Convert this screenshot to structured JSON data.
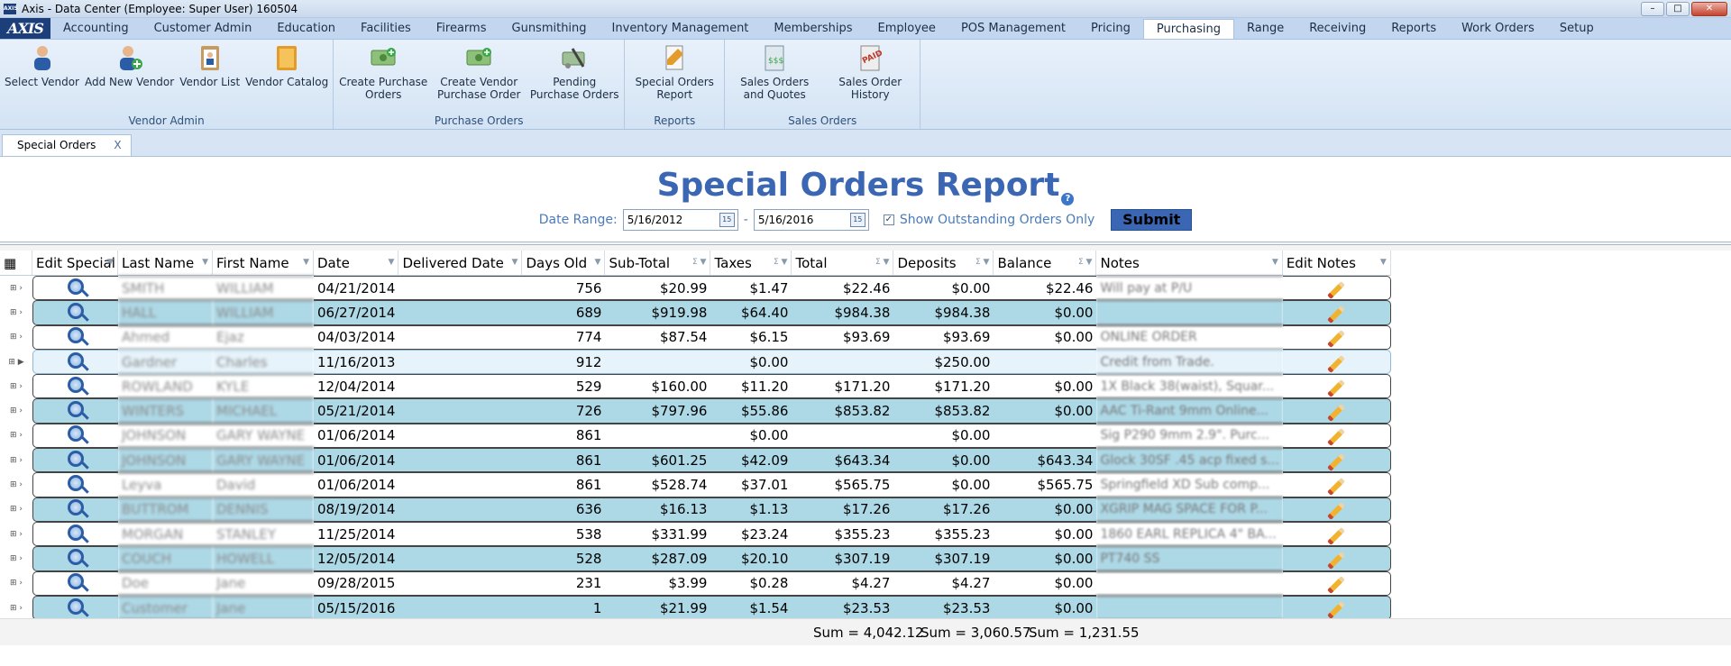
{
  "window": {
    "title": "Axis - Data Center  (Employee: Super User) 160504",
    "app_icon": "AXIS"
  },
  "logo": "AXIS",
  "menu": [
    "Accounting",
    "Customer Admin",
    "Education",
    "Facilities",
    "Firearms",
    "Gunsmithing",
    "Inventory Management",
    "Memberships",
    "Employee",
    "POS Management",
    "Pricing",
    "Purchasing",
    "Range",
    "Receiving",
    "Reports",
    "Work Orders",
    "Setup"
  ],
  "menu_active": "Purchasing",
  "ribbon": {
    "groups": [
      {
        "label": "Vendor Admin",
        "buttons": [
          {
            "label": "Select Vendor",
            "icon": "person-icon"
          },
          {
            "label": "Add New Vendor",
            "icon": "add-person-icon"
          },
          {
            "label": "Vendor List",
            "icon": "clipboard-person-icon"
          },
          {
            "label": "Vendor Catalog",
            "icon": "catalog-icon"
          }
        ]
      },
      {
        "label": "Purchase Orders",
        "buttons": [
          {
            "label": "Create Purchase Orders",
            "icon": "money-add-icon"
          },
          {
            "label": "Create Vendor Purchase Order",
            "icon": "money-add-icon"
          },
          {
            "label": "Pending Purchase Orders",
            "icon": "pending-icon"
          }
        ]
      },
      {
        "label": "Reports",
        "buttons": [
          {
            "label": "Special Orders Report",
            "icon": "report-icon"
          }
        ]
      },
      {
        "label": "Sales Orders",
        "buttons": [
          {
            "label": "Sales Orders and Quotes",
            "icon": "invoice-icon"
          },
          {
            "label": "Sales Order History",
            "icon": "paid-stamp-icon"
          }
        ]
      }
    ]
  },
  "doc_tab": {
    "label": "Special Orders",
    "close": "X"
  },
  "report": {
    "title": "Special Orders Report",
    "help": "?",
    "date_range_label": "Date Range:",
    "date_from": "5/16/2012",
    "date_to": "5/16/2016",
    "date_separator": "-",
    "calendar_glyph": "15",
    "show_outstanding_label": "Show Outstanding Orders Only",
    "show_outstanding_checked": true,
    "submit_label": "Submit"
  },
  "grid": {
    "columns": [
      "Edit Special (",
      "Last Name",
      "First Name",
      "Date",
      "Delivered Date",
      "Days Old",
      "Sub-Total",
      "Taxes",
      "Total",
      "Deposits",
      "Balance",
      "Notes",
      "Edit Notes"
    ],
    "rows": [
      {
        "last": "SMITH",
        "first": "WILLIAM",
        "date": "04/21/2014",
        "delivered": "",
        "days": "756",
        "subtotal": "$20.99",
        "taxes": "$1.47",
        "total": "$22.46",
        "deposits": "$0.00",
        "balance": "$22.46",
        "notes": "Will pay at P/U"
      },
      {
        "last": "HALL",
        "first": "WILLIAM",
        "date": "06/27/2014",
        "delivered": "",
        "days": "689",
        "subtotal": "$919.98",
        "taxes": "$64.40",
        "total": "$984.38",
        "deposits": "$984.38",
        "balance": "$0.00",
        "notes": ""
      },
      {
        "last": "Ahmed",
        "first": "Ejaz",
        "date": "04/03/2014",
        "delivered": "",
        "days": "774",
        "subtotal": "$87.54",
        "taxes": "$6.15",
        "total": "$93.69",
        "deposits": "$93.69",
        "balance": "$0.00",
        "notes": "ONLINE ORDER"
      },
      {
        "last": "Gardner",
        "first": "Charles",
        "date": "11/16/2013",
        "delivered": "",
        "days": "912",
        "subtotal": "",
        "taxes": "$0.00",
        "total": "",
        "deposits": "$250.00",
        "balance": "",
        "notes": "Credit from Trade."
      },
      {
        "last": "ROWLAND",
        "first": "KYLE",
        "date": "12/04/2014",
        "delivered": "",
        "days": "529",
        "subtotal": "$160.00",
        "taxes": "$11.20",
        "total": "$171.20",
        "deposits": "$171.20",
        "balance": "$0.00",
        "notes": "1X Black 38(waist), Squar..."
      },
      {
        "last": "WINTERS",
        "first": "MICHAEL",
        "date": "05/21/2014",
        "delivered": "",
        "days": "726",
        "subtotal": "$797.96",
        "taxes": "$55.86",
        "total": "$853.82",
        "deposits": "$853.82",
        "balance": "$0.00",
        "notes": "AAC Ti-Rant 9mm Online..."
      },
      {
        "last": "JOHNSON",
        "first": "GARY WAYNE",
        "date": "01/06/2014",
        "delivered": "",
        "days": "861",
        "subtotal": "",
        "taxes": "$0.00",
        "total": "",
        "deposits": "$0.00",
        "balance": "",
        "notes": "Sig P290 9mm 2.9\". Purc..."
      },
      {
        "last": "JOHNSON",
        "first": "GARY WAYNE",
        "date": "01/06/2014",
        "delivered": "",
        "days": "861",
        "subtotal": "$601.25",
        "taxes": "$42.09",
        "total": "$643.34",
        "deposits": "$0.00",
        "balance": "$643.34",
        "notes": "Glock 30SF .45 acp fixed s..."
      },
      {
        "last": "Leyva",
        "first": "David",
        "date": "01/06/2014",
        "delivered": "",
        "days": "861",
        "subtotal": "$528.74",
        "taxes": "$37.01",
        "total": "$565.75",
        "deposits": "$0.00",
        "balance": "$565.75",
        "notes": "Springfield XD Sub comp..."
      },
      {
        "last": "BUTTROM",
        "first": "DENNIS",
        "date": "08/19/2014",
        "delivered": "",
        "days": "636",
        "subtotal": "$16.13",
        "taxes": "$1.13",
        "total": "$17.26",
        "deposits": "$17.26",
        "balance": "$0.00",
        "notes": "XGRIP MAG SPACE FOR P..."
      },
      {
        "last": "MORGAN",
        "first": "STANLEY",
        "date": "11/25/2014",
        "delivered": "",
        "days": "538",
        "subtotal": "$331.99",
        "taxes": "$23.24",
        "total": "$355.23",
        "deposits": "$355.23",
        "balance": "$0.00",
        "notes": "1860 EARL REPLICA 4\" BA..."
      },
      {
        "last": "COUCH",
        "first": "HOWELL",
        "date": "12/05/2014",
        "delivered": "",
        "days": "528",
        "subtotal": "$287.09",
        "taxes": "$20.10",
        "total": "$307.19",
        "deposits": "$307.19",
        "balance": "$0.00",
        "notes": "PT740 SS"
      },
      {
        "last": "Doe",
        "first": "Jane",
        "date": "09/28/2015",
        "delivered": "",
        "days": "231",
        "subtotal": "$3.99",
        "taxes": "$0.28",
        "total": "$4.27",
        "deposits": "$4.27",
        "balance": "$0.00",
        "notes": ""
      },
      {
        "last": "Customer",
        "first": "Jane",
        "date": "05/15/2016",
        "delivered": "",
        "days": "1",
        "subtotal": "$21.99",
        "taxes": "$1.54",
        "total": "$23.53",
        "deposits": "$23.53",
        "balance": "$0.00",
        "notes": ""
      }
    ],
    "selected_row_index": 3,
    "sums": [
      "Sum = 4,042.12",
      "Sum = 3,060.57",
      "Sum = 1,231.55"
    ]
  }
}
